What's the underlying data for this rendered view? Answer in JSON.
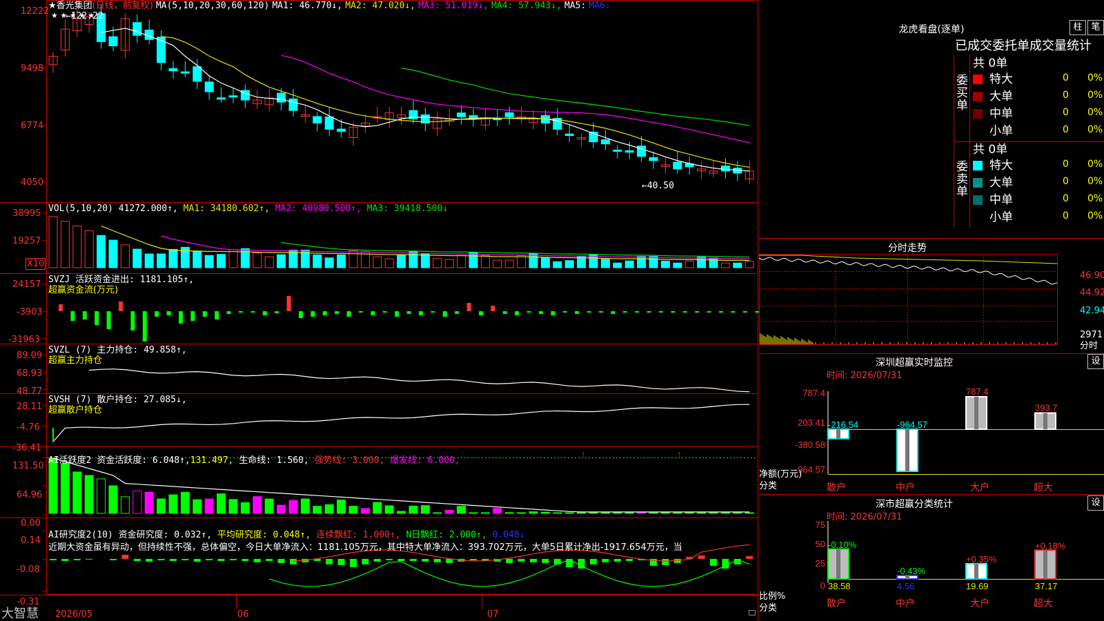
{
  "colors": {
    "up": "#ff3232",
    "down": "#00ffff",
    "ma1": "#ffffff",
    "ma2": "#e6e600",
    "ma3": "#ff00ff",
    "ma4": "#00e000",
    "ma5": "#0000ff",
    "grid": "#cc0000",
    "green": "#00ff00",
    "magenta": "#ff00ff",
    "yellow": "#ffff00"
  },
  "stock": {
    "name": "★香光集团",
    "period": "(日线，前复权)",
    "ma_params": "MA(5,10,20,30,60,120)",
    "ma1": "MA1: 46.770↓,",
    "ma2": "MA2: 47.020↓,",
    "ma3": "MA3: 51.019↓,",
    "ma4": "MA4: 57.943↓,",
    "ma5": "MA5:",
    "ma6": "MA6:",
    "stars": "★ ★ ★ ★ ★",
    "high_mark": "←122.22",
    "low_mark": "←40.50"
  },
  "price_axis": [
    "12222",
    "9498",
    "6774",
    "4050"
  ],
  "vol": {
    "params": "VOL(5,10,20)",
    "value": "41272.000↑,",
    "ma1": "MA1: 34180.602↑,",
    "ma2": "MA2: 40980.500↑,",
    "ma3": "MA3: 39418.500↓",
    "axis": [
      "38995",
      "19257"
    ],
    "unit": "X10"
  },
  "svzj": {
    "name": "SVZJ",
    "desc": "活跃资金进出: 1181.105↑,",
    "sub": "超赢资金流(万元)",
    "axis": [
      "24157",
      "-3903",
      "-31963"
    ]
  },
  "svzl": {
    "name": "SVZL (7)",
    "desc": "主力持仓: 49.858↑,",
    "sub": "超赢主力持仓",
    "axis": [
      "89.09",
      "68.93",
      "48.77"
    ]
  },
  "svsh": {
    "name": "SVSH (7)",
    "desc": "散户持仓: 27.085↓,",
    "sub": "超赢散户持仓",
    "axis": [
      "28.11",
      "-4.76",
      "-36.41"
    ]
  },
  "ai1": {
    "name": "AI活跃度2",
    "desc": "资金活跃度: 6.048↑,",
    "v2": "131.497,",
    "life": "生命线: 1.560,",
    "strong": "强势线: 3.000,",
    "burst": "爆发线: 6.000,",
    "axis": [
      "131.50",
      "64.96",
      "0.00"
    ]
  },
  "ai2": {
    "name": "AI研究度2(10)",
    "desc": "资金研究度: 0.032↑,",
    "avg": "平均研究度: 0.048↑,",
    "cont": "连续飘红: 1.000↑,",
    "nday": "N日飘红: 2.000↑,",
    "last": "0.048↓",
    "comment": "近期大资金虽有异动，但持续性不强，总体偏空，今日大单净流入：1181.105万元，其中特大单净流入：393.702万元，大单5日累计净出-1917.654万元，当",
    "axis": [
      "0.14",
      "-0.08",
      "-0.31"
    ]
  },
  "dates": [
    "2026/05",
    "06",
    "07"
  ],
  "logo": "大智慧",
  "lhb": {
    "title": "龙虎看盘(逐单)",
    "btn1": "柱",
    "btn2": "笔",
    "tabs": "已成交委托单成交量统计",
    "buy_label": "委买单",
    "sell_label": "委卖单",
    "buy_total": "共 0单",
    "sell_total": "共 0单",
    "buy_rows": [
      {
        "name": "特大",
        "n": "0",
        "p": "0%",
        "c": "#ff0000"
      },
      {
        "name": "大单",
        "n": "0",
        "p": "0%",
        "c": "#a00000"
      },
      {
        "name": "中单",
        "n": "0",
        "p": "0%",
        "c": "#700000"
      },
      {
        "name": "小单",
        "n": "0",
        "p": "0%",
        "c": ""
      }
    ],
    "sell_rows": [
      {
        "name": "特大",
        "n": "0",
        "p": "0%",
        "c": "#00ffff"
      },
      {
        "name": "大单",
        "n": "0",
        "p": "0%",
        "c": "#009090"
      },
      {
        "name": "中单",
        "n": "0",
        "p": "0%",
        "c": "#006e6e"
      },
      {
        "name": "小单",
        "n": "0",
        "p": "0%",
        "c": ""
      }
    ]
  },
  "fenshi": {
    "title": "分时走势",
    "axis": [
      "46.90",
      "44.92",
      "42.94"
    ],
    "vol": "2971",
    "vol_label": "分时"
  },
  "monitor": {
    "title": "深圳超赢实时监控",
    "btn": "设",
    "time": "时间: 2026/07/31",
    "axis": [
      "787.4",
      "203.41",
      "-380.58",
      "-964.57"
    ],
    "ylabel": "净额(万元)",
    "xlabel": "分类",
    "cats": [
      "散户",
      "中户",
      "大户",
      "超大"
    ],
    "values": [
      -216.54,
      -964.57,
      787.4,
      393.7
    ],
    "labels": [
      "-216.54",
      "-964.57",
      "787.4",
      "393.7"
    ]
  },
  "classify": {
    "title": "深市超赢分类统计",
    "btn": "设",
    "time": "时间: 2026/07/31",
    "axis": [
      "75",
      "50",
      "25",
      "0"
    ],
    "ylabel": "比例%",
    "xlabel": "分类",
    "cats": [
      "散户",
      "中户",
      "大户",
      "超大"
    ],
    "values": [
      38.58,
      4.56,
      19.69,
      37.17
    ],
    "values_text": [
      "38.58",
      "4.56",
      "19.69",
      "37.17"
    ],
    "pct": [
      "-0.10%",
      "-0.43%",
      "+0.35%",
      "+0.18%"
    ]
  }
}
